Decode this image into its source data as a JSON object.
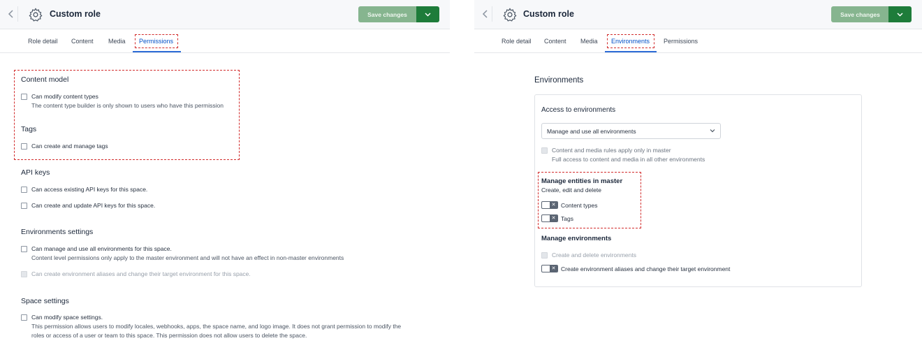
{
  "left": {
    "header": {
      "title": "Custom role",
      "save_label": "Save changes"
    },
    "tabs": [
      "Role detail",
      "Content",
      "Media",
      "Permissions"
    ],
    "content_model": {
      "heading": "Content model",
      "option": "Can modify content types",
      "desc": "The content type builder is only shown to users who have this permission"
    },
    "tags": {
      "heading": "Tags",
      "option": "Can create and manage tags"
    },
    "api_keys": {
      "heading": "API keys",
      "option1": "Can access existing API keys for this space.",
      "option2": "Can create and update API keys for this space."
    },
    "env_settings": {
      "heading": "Environments settings",
      "option1": "Can manage and use all environments for this space.",
      "desc1": "Content level permissions only apply to the master environment and will not have an effect in non-master environments",
      "option2": "Can create environment aliases and change their target environment for this space."
    },
    "space_settings": {
      "heading": "Space settings",
      "option": "Can modify space settings.",
      "desc_line1": "This permission allows users to modify locales, webhooks, apps, the space name, and logo image. It does not grant permission to modify the",
      "desc_line2": "roles or access of a user or team to this space. This permission does not allow users to delete the space."
    }
  },
  "right": {
    "header": {
      "title": "Custom role",
      "save_label": "Save changes"
    },
    "tabs": [
      "Role detail",
      "Content",
      "Media",
      "Environments",
      "Permissions"
    ],
    "section_title": "Environments",
    "access": {
      "heading": "Access to environments",
      "select_value": "Manage and use all environments",
      "rule": "Content and media rules apply only in master",
      "rule_desc": "Full access to content and media in all other environments"
    },
    "manage_entities": {
      "heading": "Manage entities in master",
      "sub": "Create, edit and delete",
      "toggle1": "Content types",
      "toggle2": "Tags"
    },
    "manage_envs": {
      "heading": "Manage environments",
      "option1": "Create and delete environments",
      "option2": "Create environment aliases and change their target environment"
    }
  }
}
